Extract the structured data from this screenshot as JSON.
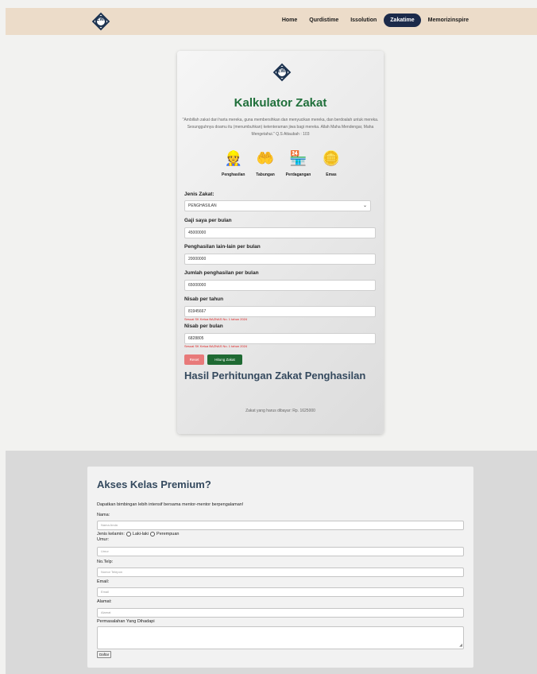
{
  "navbar": {
    "logo_text": "EWI",
    "links": [
      {
        "label": "Home",
        "active": false
      },
      {
        "label": "Qurdistime",
        "active": false
      },
      {
        "label": "Issolution",
        "active": false
      },
      {
        "label": "Zakatime",
        "active": true
      },
      {
        "label": "Memorizinspire",
        "active": false
      }
    ]
  },
  "calculator": {
    "logo_text": "EWI",
    "title": "Kalkulator Zakat",
    "quote": "\"Ambillah zakat dari harta mereka, guna membersihkan dan menyucikan mereka, dan berdoalah untuk mereka. Sesungguhnya doamu itu (menumbuhkan) ketenteraman jiwa bagi mereka. Allah Maha Mendengar, Maha Mengetahui.\" Q.S Attaubah : 103",
    "types": [
      {
        "label": "Penghasilan",
        "icon": "worker-icon"
      },
      {
        "label": "Tabungan",
        "icon": "savings-icon"
      },
      {
        "label": "Perdagangan",
        "icon": "shop-icon"
      },
      {
        "label": "Emas",
        "icon": "gold-icon"
      }
    ],
    "jenis_label": "Jenis Zakat:",
    "jenis_value": "PENGHASILAN",
    "gaji_label": "Gaji saya per bulan",
    "gaji_value": "45000000",
    "lain_label": "Penghasilan lain-lain per bulan",
    "lain_value": "20000000",
    "jumlah_label": "Jumlah penghasilan per bulan",
    "jumlah_value": "65000000",
    "nisab_tahun_label": "Nisab per tahun",
    "nisab_tahun_value": "81945667",
    "nisab_tahun_note": "Sesuai SK Ketua BAZNAS No. 1 tahun 2024",
    "nisab_bulan_label": "Nisab per bulan",
    "nisab_bulan_value": "6828805",
    "nisab_bulan_note": "Sesuai SK Ketua BAZNAS No. 1 tahun 2024",
    "reset_label": "Reset",
    "hitung_label": "Hitung Zakat",
    "hasil_title": "Hasil Perhitungan Zakat Penghasilan",
    "hasil_text": "Zakat yang harus dibayar: Rp. 1625000"
  },
  "premium": {
    "title": "Akses Kelas Premium?",
    "subtitle": "Dapatkan bimbingan lebih intensif bersama mentor-mentor berpengalaman!",
    "nama_label": "Nama:",
    "nama_placeholder": "Nama Anda",
    "gender_label": "Jenis kelamin:",
    "gender_male": "Laki-laki",
    "gender_female": "Perempuan",
    "umur_label": "Umur:",
    "umur_placeholder": "Umur",
    "telp_label": "No.Telp:",
    "telp_placeholder": "Nomor Telepon",
    "email_label": "Email:",
    "email_placeholder": "Email",
    "alamat_label": "Alamat:",
    "alamat_placeholder": "Alamat",
    "masalah_label": "Permasalahan Yang Dihadapi",
    "daftar_label": "Daftar"
  }
}
